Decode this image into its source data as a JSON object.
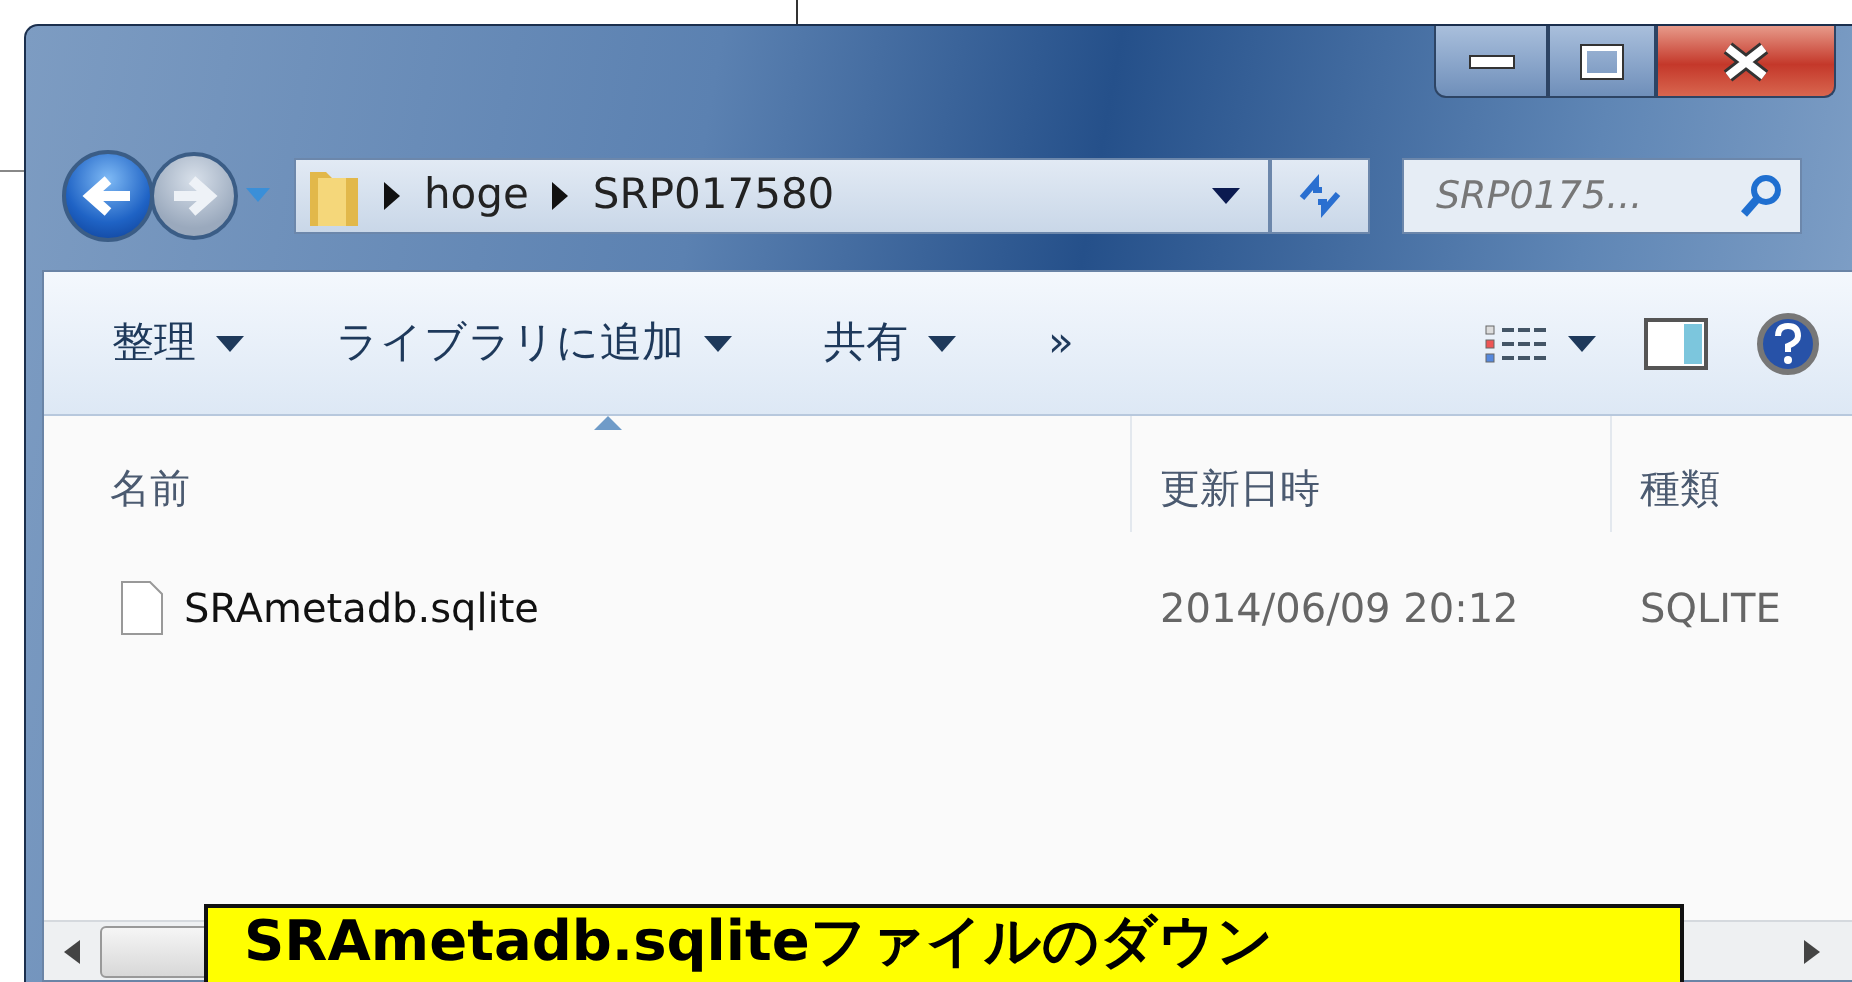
{
  "address_bar": {
    "breadcrumbs": [
      "hoge",
      "SRP017580"
    ]
  },
  "search": {
    "placeholder": "SRP0175..."
  },
  "toolbar": [
    {
      "label": "整理",
      "dropdown": true
    },
    {
      "label": "ライブラリに追加",
      "dropdown": true
    },
    {
      "label": "共有",
      "dropdown": true
    },
    {
      "label": "»",
      "dropdown": false
    }
  ],
  "columns": [
    {
      "label": "名前",
      "sorted": true
    },
    {
      "label": "更新日時",
      "sorted": false
    },
    {
      "label": "種類",
      "sorted": false
    }
  ],
  "rows": [
    {
      "name": "SRAmetadb.sqlite",
      "modified": "2014/06/09 20:12",
      "type": "SQLITE"
    }
  ],
  "callout": {
    "text": "SRAmetadb.sqliteファイルのダウン"
  }
}
